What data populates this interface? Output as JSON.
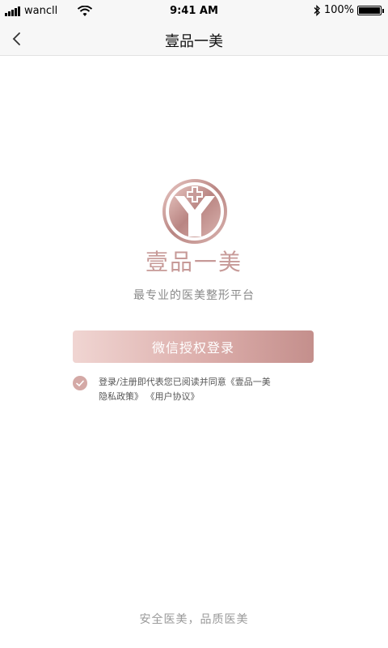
{
  "status_bar": {
    "carrier": "wancll",
    "time": "9:41 AM",
    "battery": "100%",
    "battery_level": 1.0
  },
  "nav": {
    "back_icon": "chevron-left-icon",
    "title": "壹品一美"
  },
  "brand": {
    "name": "壹品一美",
    "slogan": "最专业的医美整形平台",
    "logo_icon": "brand-logo-icon",
    "accent_color": "#c79a98"
  },
  "login": {
    "button_label": "微信授权登录"
  },
  "agreement": {
    "checked": true,
    "text_line1": "登录/注册即代表您已阅读并同意《壹品一美",
    "privacy_policy": "隐私政策》",
    "user_agreement": "《用户协议》"
  },
  "footer": {
    "slogan": "安全医美，品质医美"
  }
}
